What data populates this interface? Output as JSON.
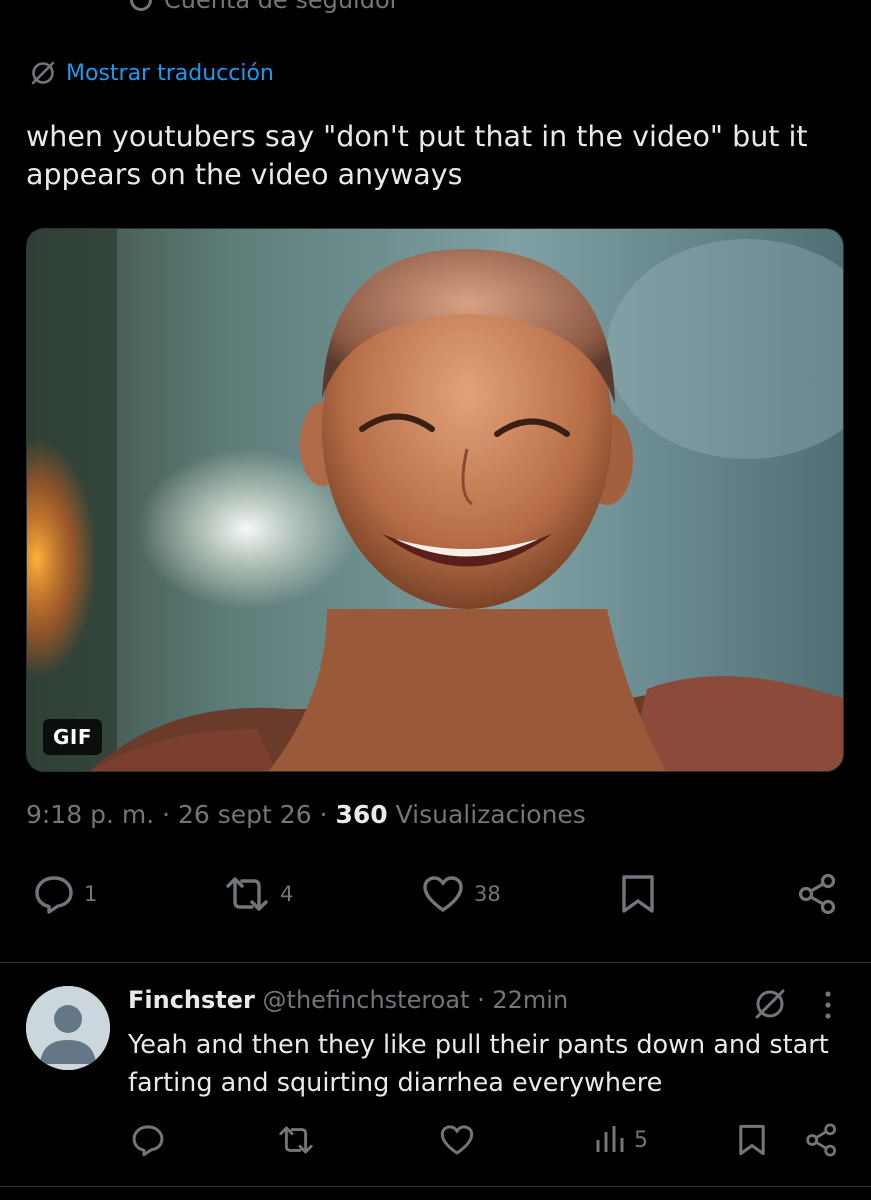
{
  "header": {
    "cutoff_text": "Cuenta de seguidor"
  },
  "tweet": {
    "translate_label": "Mostrar traducción",
    "text": "when youtubers say \"don't put that in the video\" but it appears on the video anyways",
    "media": {
      "badge": "GIF"
    },
    "time": "9:18 p. m.",
    "sep1": " · ",
    "date": "26 sept 26",
    "sep2": " · ",
    "views_count": "360",
    "views_label": " Visualizaciones",
    "stats": {
      "replies": "1",
      "reposts": "4",
      "likes": "38"
    }
  },
  "reply": {
    "name": "Finchster",
    "handle": "@thefinchsteroat",
    "sep": " · ",
    "time": "22min",
    "text": "Yeah and then they like pull their pants down and start farting and squirting diarrhea everywhere",
    "stats": {
      "views": "5"
    }
  },
  "colors": {
    "background": "#000000",
    "text_primary": "#e7e9ea",
    "text_secondary": "#71767b",
    "link": "#1d9bf0",
    "divider": "#2f3336"
  }
}
